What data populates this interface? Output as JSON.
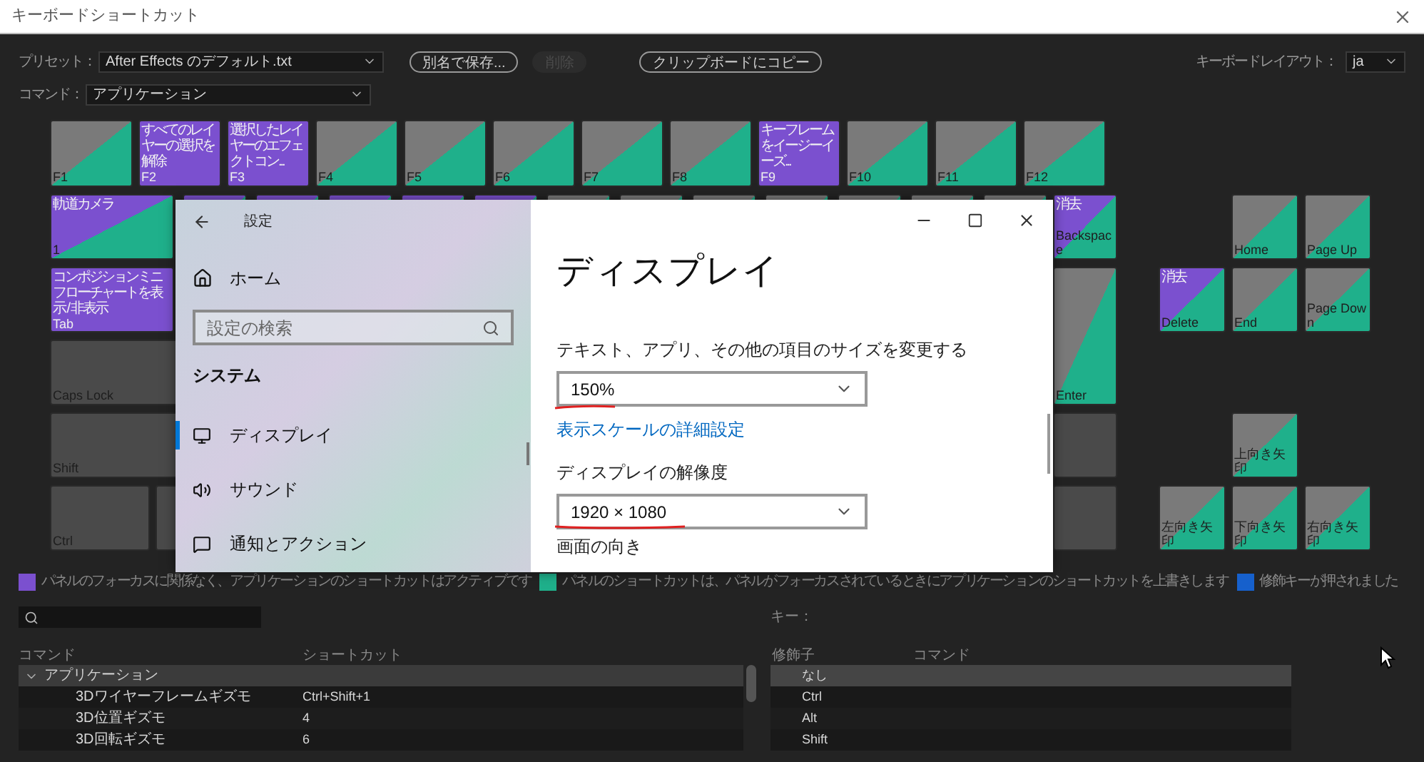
{
  "window": {
    "title": "キーボードショートカット"
  },
  "preset": {
    "label": "プリセット：",
    "value": "After Effects のデフォルト.txt"
  },
  "buttons": [
    {
      "label": "別名で保存...",
      "disabled": false
    },
    {
      "label": "削除",
      "disabled": true
    },
    {
      "label": "クリップボードにコピー",
      "disabled": false
    }
  ],
  "keyboard_layout": {
    "label": "キーボードレイアウト：",
    "value": "ja"
  },
  "command": {
    "label": "コマンド：",
    "value": "アプリケーション"
  },
  "function_keys": [
    {
      "key": "F1",
      "kind": "panel"
    },
    {
      "key": "F2",
      "command": "すべてのレイヤーの選択を解除",
      "kind": "app"
    },
    {
      "key": "F3",
      "command": "選択したレイヤーのエフェクトコン...",
      "kind": "app"
    },
    {
      "key": "F4",
      "kind": "panel"
    },
    {
      "key": "F5",
      "kind": "panel"
    },
    {
      "key": "F6",
      "kind": "panel"
    },
    {
      "key": "F7",
      "kind": "panel"
    },
    {
      "key": "F8",
      "kind": "panel"
    },
    {
      "key": "F9",
      "command": "キーフレームをイージーイーズ...",
      "kind": "app"
    },
    {
      "key": "F10",
      "kind": "panel"
    },
    {
      "key": "F11",
      "kind": "panel"
    },
    {
      "key": "F12",
      "kind": "panel"
    }
  ],
  "number_row": [
    {
      "key": "1",
      "command": "軌道カメラ",
      "kind": "app_panel"
    },
    {
      "kind": "app_panel"
    },
    {
      "kind": "app_panel"
    },
    {
      "kind": "app_panel"
    },
    {
      "kind": "app_panel"
    },
    {
      "kind": "app_panel"
    },
    {
      "kind": "panel"
    },
    {
      "kind": "panel"
    },
    {
      "kind": "panel"
    },
    {
      "kind": "panel"
    },
    {
      "kind": "panel"
    },
    {
      "kind": "panel"
    },
    {
      "kind": "panel"
    }
  ],
  "left_keys": [
    {
      "key": "Tab",
      "command": "コンポジションミニフローチャートを表示 / 非表示",
      "kind": "app"
    },
    {
      "key": "Caps Lock",
      "kind": "none"
    },
    {
      "key": "Shift",
      "kind": "none"
    },
    {
      "key": "Ctrl",
      "kind": "none"
    },
    {
      "kind": "none"
    }
  ],
  "right_column": [
    {
      "key": "Backspace",
      "command": "消去",
      "kind": "app_panel"
    },
    {
      "key": "Enter",
      "kind": "panel"
    },
    {
      "kind": "none"
    },
    {
      "kind": "none"
    }
  ],
  "nav_keys": [
    {
      "key": "Home",
      "kind": "panel"
    },
    {
      "key": "Page Up",
      "kind": "panel"
    },
    {
      "key": "Delete",
      "command": "消去",
      "kind": "app_panel"
    },
    {
      "key": "End",
      "kind": "panel"
    },
    {
      "key": "Page Down",
      "kind": "panel"
    },
    {
      "key": "上向き矢印",
      "kind": "panel"
    },
    {
      "key": "左向き矢印",
      "kind": "panel"
    },
    {
      "key": "下向き矢印",
      "kind": "panel"
    },
    {
      "key": "右向き矢印",
      "kind": "panel"
    }
  ],
  "settings": {
    "title": "設定",
    "home": "ホーム",
    "search": {
      "placeholder": "設定の検索"
    },
    "section": "システム",
    "nav": [
      {
        "label": "ディスプレイ",
        "selected": true,
        "kind": "display"
      },
      {
        "label": "サウンド",
        "selected": false,
        "kind": "sound"
      },
      {
        "label": "通知とアクション",
        "selected": false,
        "kind": "notify"
      }
    ],
    "heading": "ディスプレイ",
    "scale_label": "テキスト、アプリ、その他の項目のサイズを変更する",
    "scale_value": "150%",
    "scale_link": "表示スケールの詳細設定",
    "resolution_label": "ディスプレイの解像度",
    "resolution_value": "1920 × 1080",
    "orientation_label": "画面の向き"
  },
  "legend": [
    {
      "text": "パネルのフォーカスに関係なく、アプリケーションのショートカットはアクティブです",
      "color": "#7b50cf"
    },
    {
      "text": "パネルのショートカットは、パネルがフォーカスされているときにアプリケーションのショートカットを上書きします",
      "color": "#1fb08b"
    },
    {
      "text": "修飾キーが押されました",
      "color": "#1660cc"
    }
  ],
  "key_label": "キー：",
  "command_table": {
    "columns": [
      "コマンド",
      "ショートカット"
    ],
    "rows": [
      {
        "command": "アプリケーション",
        "expanded": true,
        "children": [
          {
            "command": "3Dワイヤーフレームギズモ",
            "shortcut": "Ctrl+Shift+1"
          },
          {
            "command": "3D位置ギズモ",
            "shortcut": "4"
          },
          {
            "command": "3D回転ギズモ",
            "shortcut": "6"
          }
        ]
      }
    ]
  },
  "modifier_table": {
    "columns": [
      "修飾子",
      "コマンド"
    ],
    "rows": [
      {
        "modifier": "なし",
        "selected": true
      },
      {
        "modifier": "Ctrl",
        "selected": false
      },
      {
        "modifier": "Alt",
        "selected": false
      },
      {
        "modifier": "Shift",
        "selected": false
      }
    ]
  }
}
